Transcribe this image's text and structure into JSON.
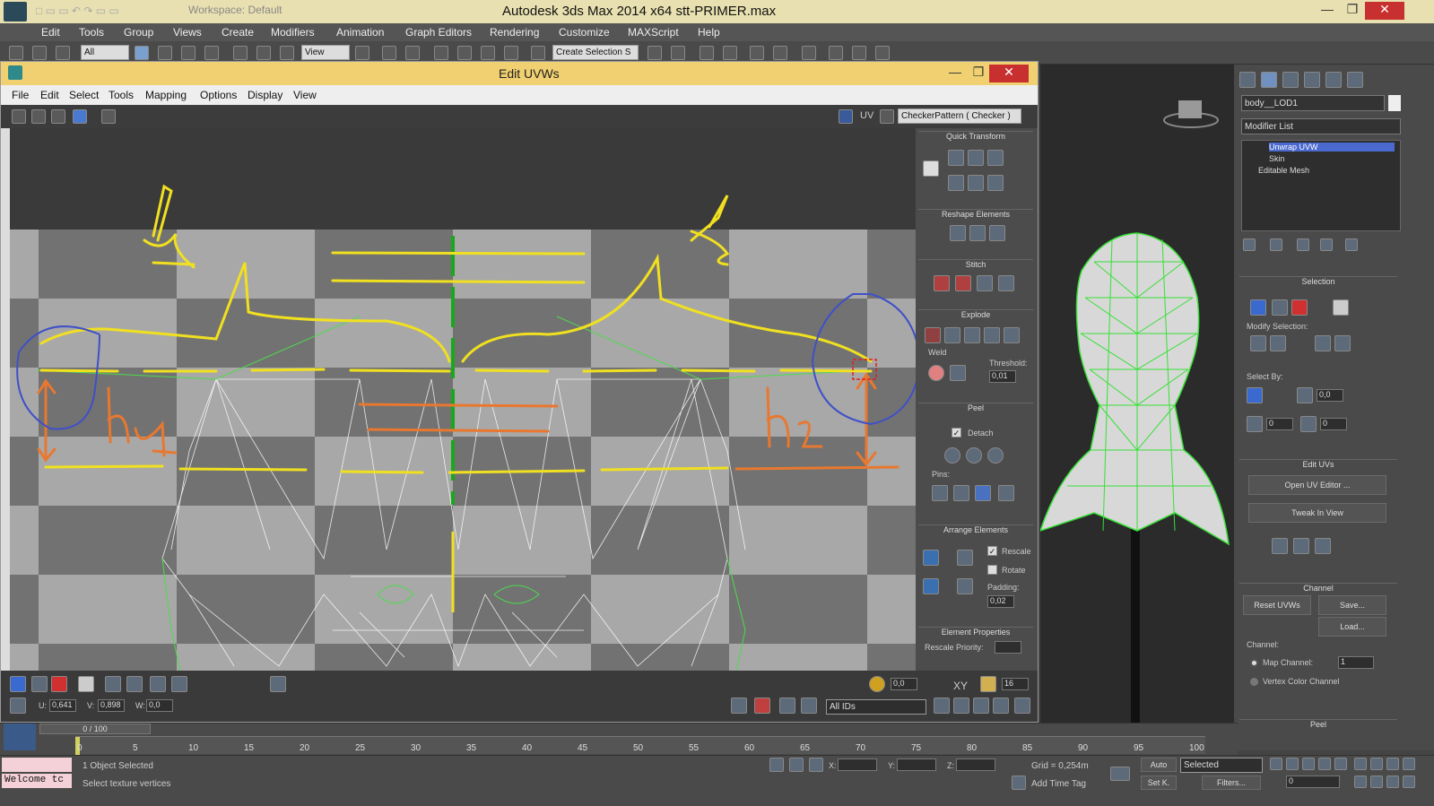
{
  "app": {
    "title": "Autodesk 3ds Max  2014 x64      stt-PRIMER.max",
    "workspace": "Workspace: Default"
  },
  "menubar": [
    "Edit",
    "Tools",
    "Group",
    "Views",
    "Create",
    "Modifiers",
    "Animation",
    "Graph Editors",
    "Rendering",
    "Customize",
    "MAXScript",
    "Help"
  ],
  "maintoolbar": {
    "filter": "All",
    "refcoord": "View",
    "named_selection": "Create Selection S"
  },
  "uv_editor": {
    "title": "Edit UVWs",
    "menu": [
      "File",
      "Edit",
      "Select",
      "Tools",
      "Mapping",
      "Options",
      "Display",
      "View"
    ],
    "uv_label": "UV",
    "checker_dropdown": "CheckerPattern  ( Checker )",
    "panel": {
      "quick_transform": "Quick Transform",
      "reshape": "Reshape Elements",
      "stitch": "Stitch",
      "explode": "Explode",
      "weld": "Weld",
      "threshold_label": "Threshold:",
      "threshold": "0,01",
      "peel": "Peel",
      "detach": "Detach",
      "pins": "Pins:",
      "arrange": "Arrange Elements",
      "rescale": "Rescale",
      "rotate": "Rotate",
      "padding_label": "Padding:",
      "padding": "0,02",
      "element_props": "Element Properties",
      "rescale_priority": "Rescale Priority:"
    },
    "bottom": {
      "u_label": "U:",
      "u": "0,641",
      "v_label": "V:",
      "v": "0,898",
      "w_label": "W:",
      "w": "0,0",
      "soft": "0,0",
      "xy": "XY",
      "num": "16",
      "ids": "All IDs"
    },
    "annotations": {
      "l1": "l1",
      "l2": "l2",
      "h1": "h1",
      "h2": "h2"
    }
  },
  "command_panel": {
    "object_name": "body__LOD1",
    "modifier_list": "Modifier List",
    "stack": [
      "Unwrap UVW",
      "Skin",
      "Editable Mesh"
    ],
    "selection": "Selection",
    "modify_selection": "Modify Selection:",
    "select_by": "Select By:",
    "spin1": "0,0",
    "spin2": "0",
    "spin3": "0",
    "edit_uvs": "Edit UVs",
    "open_uv_editor": "Open UV Editor ...",
    "tweak_in_view": "Tweak In View",
    "channel": "Channel",
    "reset_uvws": "Reset UVWs",
    "save": "Save...",
    "load": "Load...",
    "channel_label": "Channel:",
    "map_channel": "Map Channel:",
    "map_channel_value": "1",
    "vertex_color_channel": "Vertex Color Channel",
    "peel": "Peel"
  },
  "timeline": {
    "frame": "0 / 100",
    "ticks": [
      "0",
      "5",
      "10",
      "15",
      "20",
      "25",
      "30",
      "35",
      "40",
      "45",
      "50",
      "55",
      "60",
      "65",
      "70",
      "75",
      "80",
      "85",
      "90",
      "95",
      "100"
    ]
  },
  "status": {
    "welcome": "Welcome tc",
    "objects": "1 Object Selected",
    "prompt": "Select texture vertices",
    "x": "X:",
    "y": "Y:",
    "z": "Z:",
    "grid": "Grid = 0,254m",
    "add_time_tag": "Add Time Tag",
    "auto": "Auto",
    "setk": "Set K.",
    "selected": "Selected",
    "filters": "Filters...",
    "frame_field": "0"
  }
}
